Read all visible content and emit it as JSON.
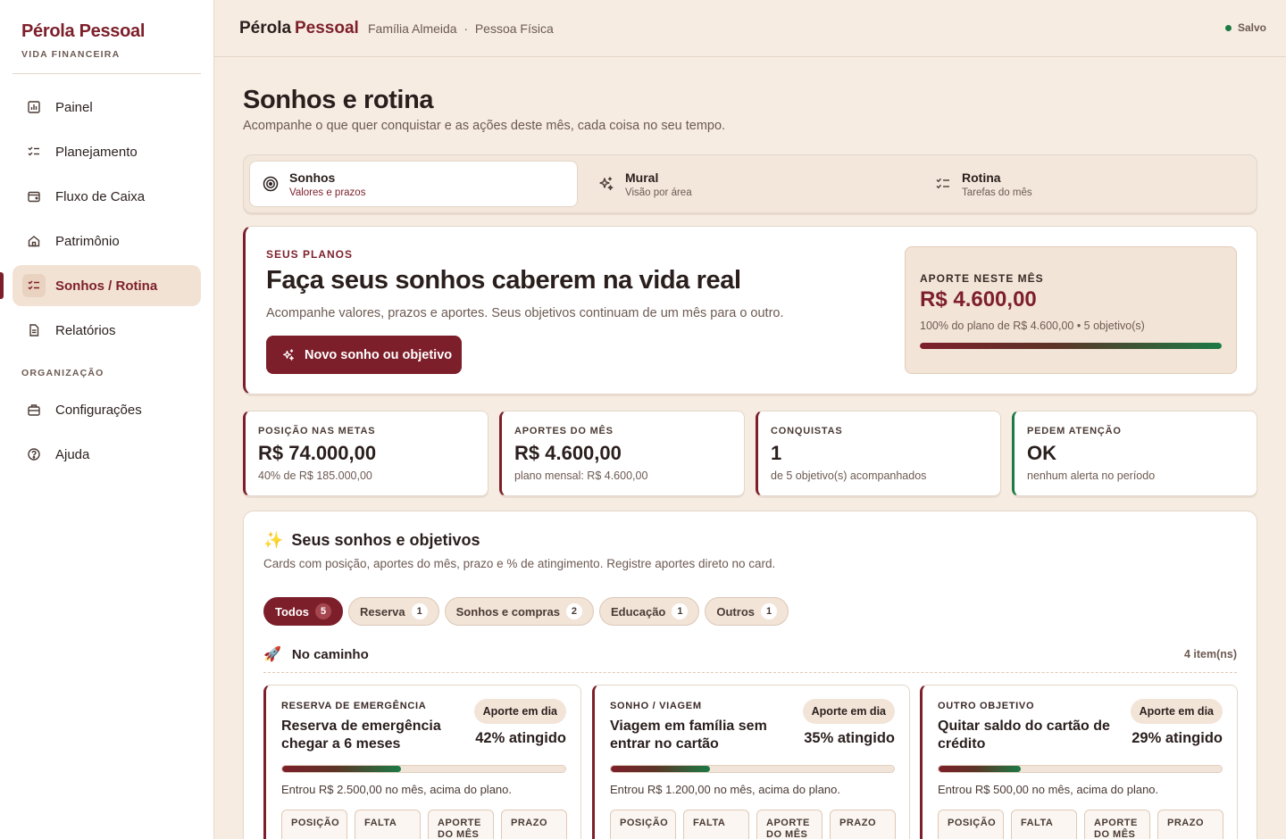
{
  "brand": {
    "name": "Pérola Pessoal",
    "subtitle": "VIDA FINANCEIRA"
  },
  "sidebar": {
    "items": [
      {
        "label": "Painel",
        "icon": "chart-icon"
      },
      {
        "label": "Planejamento",
        "icon": "checklist-icon"
      },
      {
        "label": "Fluxo de Caixa",
        "icon": "wallet-icon"
      },
      {
        "label": "Patrimônio",
        "icon": "home-icon"
      },
      {
        "label": "Sonhos / Rotina",
        "icon": "checklist-icon",
        "active": true
      },
      {
        "label": "Relatórios",
        "icon": "document-icon"
      }
    ],
    "section_label": "ORGANIZAÇÃO",
    "org_items": [
      {
        "label": "Configurações",
        "icon": "briefcase-icon"
      },
      {
        "label": "Ajuda",
        "icon": "help-icon"
      }
    ]
  },
  "topbar": {
    "title_part1": "Pérola",
    "title_part2": "Pessoal",
    "breadcrumb": "Família Almeida  ·  Pessoa Física",
    "status": "Salvo",
    "status_color": "#1c7a45"
  },
  "page": {
    "title": "Sonhos e rotina",
    "subtitle": "Acompanhe o que quer conquistar e as ações deste mês, cada coisa no seu tempo."
  },
  "tabs": [
    {
      "label": "Sonhos",
      "sub": "Valores e prazos",
      "icon": "target-icon",
      "active": true
    },
    {
      "label": "Mural",
      "sub": "Visão por área",
      "icon": "sparkle-icon"
    },
    {
      "label": "Rotina",
      "sub": "Tarefas do mês",
      "icon": "checklist-icon"
    }
  ],
  "hero": {
    "eyebrow": "SEUS PLANOS",
    "title": "Faça seus sonhos caberem na vida real",
    "subtitle": "Acompanhe valores, prazos e aportes. Seus objetivos continuam de um mês para o outro.",
    "button": "Novo sonho ou objetivo",
    "aporte": {
      "label": "APORTE NESTE MÊS",
      "value": "R$ 4.600,00",
      "sub": "100% do plano de R$ 4.600,00 • 5 objetivo(s)",
      "progress": 1.0
    }
  },
  "kpis": [
    {
      "label": "POSIÇÃO NAS METAS",
      "value": "R$ 74.000,00",
      "sub": "40% de R$ 185.000,00"
    },
    {
      "label": "APORTES DO MÊS",
      "value": "R$ 4.600,00",
      "sub": "plano mensal: R$ 4.600,00"
    },
    {
      "label": "CONQUISTAS",
      "value": "1",
      "sub": "de 5 objetivo(s) acompanhados"
    },
    {
      "label": "PEDEM ATENÇÃO",
      "value": "OK",
      "sub": "nenhum alerta no período"
    }
  ],
  "goals": {
    "title": "Seus sonhos e objetivos",
    "subtitle": "Cards com posição, aportes do mês, prazo e % de atingimento. Registre aportes direto no card.",
    "filters": [
      {
        "label": "Todos",
        "count": "5",
        "active": true
      },
      {
        "label": "Reserva",
        "count": "1"
      },
      {
        "label": "Sonhos e compras",
        "count": "2"
      },
      {
        "label": "Educação",
        "count": "1"
      },
      {
        "label": "Outros",
        "count": "1"
      }
    ],
    "group": {
      "title": "No caminho",
      "count": "4 item(ns)"
    },
    "cards": [
      {
        "eyebrow": "RESERVA DE EMERGÊNCIA",
        "title": "Reserva de emergência chegar a 6 meses",
        "badge": "Aporte em dia",
        "pct_label": "42% atingido",
        "progress": 0.42,
        "note": "Entrou R$ 2.500,00 no mês, acima do plano."
      },
      {
        "eyebrow": "SONHO / VIAGEM",
        "title": "Viagem em família sem entrar no cartão",
        "badge": "Aporte em dia",
        "pct_label": "35% atingido",
        "progress": 0.35,
        "note": "Entrou R$ 1.200,00 no mês, acima do plano."
      },
      {
        "eyebrow": "OUTRO OBJETIVO",
        "title": "Quitar saldo do cartão de crédito",
        "badge": "Aporte em dia",
        "pct_label": "29% atingido",
        "progress": 0.29,
        "note": "Entrou R$ 500,00 no mês, acima do plano."
      }
    ],
    "mini_labels": [
      "POSIÇÃO",
      "FALTA",
      "APORTE DO MÊS",
      "PRAZO"
    ]
  }
}
